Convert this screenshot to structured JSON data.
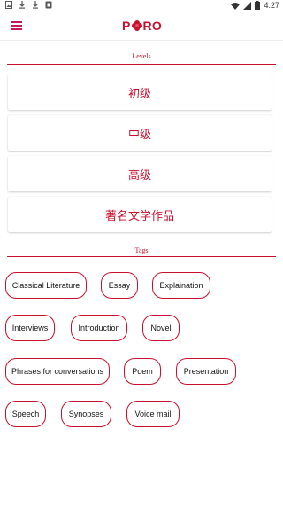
{
  "status_bar": {
    "time": "4:27",
    "left_icons": [
      "gallery-icon",
      "download-icon",
      "download-icon",
      "app-icon"
    ],
    "right_icons": [
      "wifi-icon",
      "signal-icon",
      "battery-icon"
    ]
  },
  "app_bar": {
    "logo_text_left": "P",
    "logo_text_right": "RO",
    "menu_icon": "hamburger-menu-icon"
  },
  "levels": {
    "title": "Levels",
    "items": [
      "初级",
      "中级",
      "高级",
      "著名文学作品"
    ]
  },
  "tags": {
    "title": "Tags",
    "items": [
      "Classical Literature",
      "Essay",
      "Explaination",
      "Interviews",
      "Introduction",
      "Novel",
      "Phrases for conversations",
      "Poem",
      "Presentation",
      "Speech",
      "Synopses",
      "Voice mail"
    ]
  },
  "colors": {
    "accent": "#c8102e",
    "menu": "#c2185b",
    "background": "#ffffff"
  }
}
